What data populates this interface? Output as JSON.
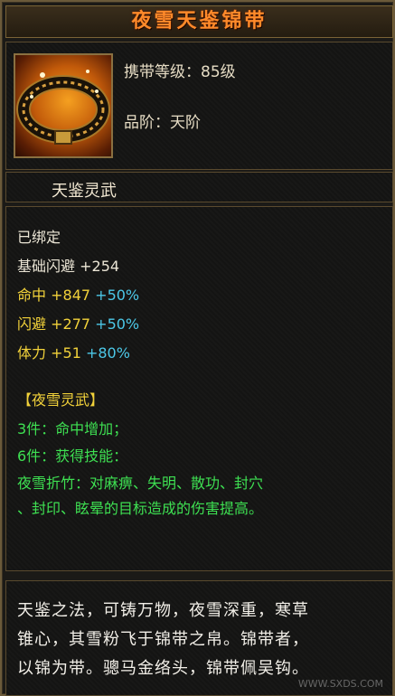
{
  "item": {
    "name": "夜雪天鉴锦带",
    "level_label": "携带等级",
    "level_value": "85级",
    "grade_label": "品阶",
    "grade_value": "天阶",
    "separator": "：",
    "set_series": "天鉴灵武",
    "icon": "belt-icon"
  },
  "stats": {
    "bound": "已绑定",
    "base_dodge": {
      "label": "基础闪避",
      "value": "+254"
    },
    "hit": {
      "label": "命中",
      "value": "+847",
      "bonus": "+50%"
    },
    "dodge": {
      "label": "闪避",
      "value": "+277",
      "bonus": "+50%"
    },
    "stamina": {
      "label": "体力",
      "value": "+51",
      "bonus": "+80%"
    }
  },
  "set": {
    "title": "【夜雪灵武】",
    "piece3": "3件：命中增加；",
    "piece6": "6件：获得技能：",
    "skill_line1": "夜雪折竹：对麻痹、失明、散功、封穴",
    "skill_line2": "、封印、眩晕的目标造成的伤害提高。"
  },
  "description": {
    "line1": "天鉴之法，可铸万物，夜雪深重，寒草",
    "line2": "锥心，其雪粉飞于锦带之帛。锦带者，",
    "line3": "以锦为带。骢马金络头，锦带佩吴钩。"
  },
  "watermark": "WWW.SXDS.COM",
  "colors": {
    "title": "#ff8a2a",
    "stat_label": "#f2d23a",
    "bonus": "#4cc8e8",
    "set_text": "#3ee052"
  }
}
